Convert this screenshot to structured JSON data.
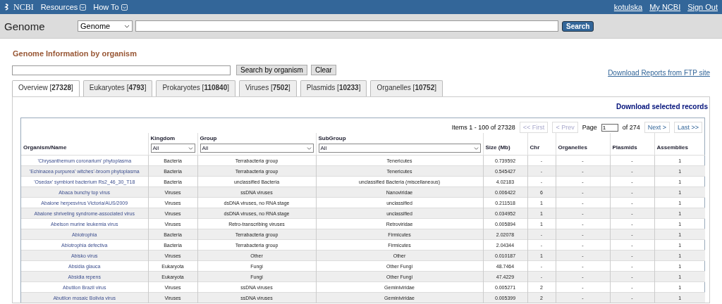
{
  "top_bar": {
    "logo": "NCBI",
    "menus": [
      "Resources",
      "How To"
    ],
    "user_links": [
      "kotulska",
      "My NCBI",
      "Sign Out"
    ]
  },
  "search_bar": {
    "title": "Genome",
    "database": "Genome",
    "button": "Search"
  },
  "heading": "Genome Information by organism",
  "organism_search": {
    "button": "Search by organism",
    "clear": "Clear",
    "ftp_link": "Download Reports from FTP site"
  },
  "tabs": [
    {
      "label": "Overview [**27328**]",
      "selected": true
    },
    {
      "label": "Eukaryotes [**4793**]",
      "selected": false
    },
    {
      "label": "Prokaryotes [**110840**]",
      "selected": false
    },
    {
      "label": "Viruses [**7502**]",
      "selected": false
    },
    {
      "label": "Plasmids [**10233**]",
      "selected": false
    },
    {
      "label": "Organelles [**10752**]",
      "selected": false
    }
  ],
  "download_selected": "Download selected records",
  "pager": {
    "items": "Items 1 - 100 of 27328",
    "first": "<< First",
    "prev": "< Prev",
    "page_label": "Page",
    "page": "1",
    "of": "of 274",
    "next": "Next >",
    "last": "Last >>"
  },
  "table": {
    "columns": [
      {
        "label": "Organism/Name"
      },
      {
        "label": "Kingdom",
        "filter": "All"
      },
      {
        "label": "Group",
        "filter": "All"
      },
      {
        "label": "SubGroup",
        "filter": "All"
      },
      {
        "label": "Size (Mb)"
      },
      {
        "label": "Chr"
      },
      {
        "label": "Organelles"
      },
      {
        "label": "Plasmids"
      },
      {
        "label": "Assemblies"
      }
    ],
    "rows": [
      [
        "'Chrysanthemum coronarium' phytoplasma",
        "Bacteria",
        "Terrabacteria group",
        "Tenericutes",
        "0.739592",
        "-",
        "-",
        "-",
        "1"
      ],
      [
        "'Echinacea purpurea' witches'-broom phytoplasma",
        "Bacteria",
        "Terrabacteria group",
        "Tenericutes",
        "0.545427",
        "-",
        "-",
        "-",
        "1"
      ],
      [
        "'Osedax' symbiont bacterium Rs2_46_30_T18",
        "Bacteria",
        "unclassified Bacteria",
        "unclassified Bacteria (miscellaneous)",
        "4.02183",
        "-",
        "-",
        "-",
        "1"
      ],
      [
        "Abaca bunchy top virus",
        "Viruses",
        "ssDNA viruses",
        "Nanoviridae",
        "0.006422",
        "6",
        "-",
        "-",
        "1"
      ],
      [
        "Abalone herpesvirus Victoria/AUS/2009",
        "Viruses",
        "dsDNA viruses, no RNA stage",
        "unclassified",
        "0.211518",
        "1",
        "-",
        "-",
        "1"
      ],
      [
        "Abalone shriveling syndrome-associated virus",
        "Viruses",
        "dsDNA viruses, no RNA stage",
        "unclassified",
        "0.034952",
        "1",
        "-",
        "-",
        "1"
      ],
      [
        "Abelson murine leukemia virus",
        "Viruses",
        "Retro-transcribing viruses",
        "Retroviridae",
        "0.005894",
        "1",
        "-",
        "-",
        "1"
      ],
      [
        "Abiotrophia",
        "Bacteria",
        "Terrabacteria group",
        "Firmicutes",
        "2.02078",
        "-",
        "-",
        "-",
        "1"
      ],
      [
        "Abiotrophia defectiva",
        "Bacteria",
        "Terrabacteria group",
        "Firmicutes",
        "2.04344",
        "-",
        "-",
        "-",
        "1"
      ],
      [
        "Abisko virus",
        "Viruses",
        "Other",
        "Other",
        "0.010187",
        "1",
        "-",
        "-",
        "1"
      ],
      [
        "Absidia glauca",
        "Eukaryota",
        "Fungi",
        "Other Fungi",
        "48.7464",
        "-",
        "-",
        "-",
        "1"
      ],
      [
        "Absidia repens",
        "Eukaryota",
        "Fungi",
        "Other Fungi",
        "47.4229",
        "-",
        "-",
        "-",
        "1"
      ],
      [
        "Abutilon Brazil virus",
        "Viruses",
        "ssDNA viruses",
        "Geminiviridae",
        "0.005271",
        "2",
        "-",
        "-",
        "1"
      ],
      [
        "Abutilon mosaic Bolivia virus",
        "Viruses",
        "ssDNA viruses",
        "Geminiviridae",
        "0.005399",
        "2",
        "-",
        "-",
        "1"
      ]
    ]
  }
}
